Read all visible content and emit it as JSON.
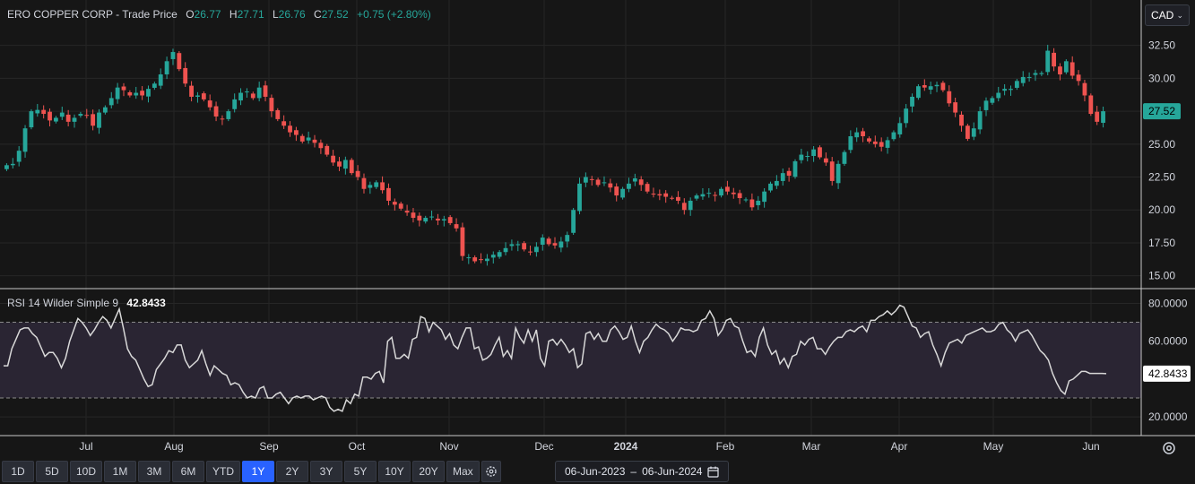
{
  "legend": {
    "symbol": "ERO COPPER CORP",
    "price_type": "- Trade Price",
    "open_label": "O",
    "open": "26.77",
    "high_label": "H",
    "high": "27.71",
    "low_label": "L",
    "low": "26.76",
    "close_label": "C",
    "close": "27.52",
    "change": "+0.75 (+2.80%)"
  },
  "currency": {
    "label": "CAD"
  },
  "price_axis": {
    "ticks": [
      "32.50",
      "30.00",
      "27.50",
      "25.00",
      "22.50",
      "20.00",
      "17.50",
      "15.00"
    ],
    "last_price_tag": "27.52"
  },
  "rsi": {
    "label": "RSI 14 Wilder Simple 9",
    "value": "42.8433",
    "ticks": [
      "80.0000",
      "60.0000",
      "20.0000"
    ],
    "value_tag": "42.8433"
  },
  "time_axis": {
    "labels": [
      "Jul",
      "Aug",
      "Sep",
      "Oct",
      "Nov",
      "Dec",
      "2024",
      "Feb",
      "Mar",
      "Apr",
      "May",
      "Jun"
    ]
  },
  "range_buttons": [
    {
      "label": "1D"
    },
    {
      "label": "5D"
    },
    {
      "label": "10D"
    },
    {
      "label": "1M"
    },
    {
      "label": "3M"
    },
    {
      "label": "6M"
    },
    {
      "label": "YTD"
    },
    {
      "label": "1Y",
      "active": true
    },
    {
      "label": "2Y"
    },
    {
      "label": "3Y"
    },
    {
      "label": "5Y"
    },
    {
      "label": "10Y"
    },
    {
      "label": "20Y"
    },
    {
      "label": "Max"
    }
  ],
  "date_range": {
    "from": "06-Jun-2023",
    "separator": "–",
    "to": "06-Jun-2024"
  },
  "colors": {
    "up": "#26a69a",
    "down": "#ef5350",
    "rsi_line": "#d8d8d8",
    "rsi_band": "#2a2533",
    "accent": "#2962ff"
  },
  "chart_data": [
    {
      "type": "candlestick",
      "title": "ERO COPPER CORP - Trade Price",
      "ylim": [
        14.5,
        33.5
      ],
      "y_ticks": [
        15,
        17.5,
        20,
        22.5,
        25,
        27.5,
        30,
        32.5
      ],
      "x_labels": [
        "Jul",
        "Aug",
        "Sep",
        "Oct",
        "Nov",
        "Dec",
        "2024",
        "Feb",
        "Mar",
        "Apr",
        "May",
        "Jun"
      ],
      "closes": [
        23.4,
        23.5,
        24.5,
        26.2,
        27.5,
        27.6,
        27.3,
        26.8,
        27.0,
        27.4,
        26.7,
        27.0,
        27.3,
        27.2,
        26.4,
        27.4,
        27.8,
        28.5,
        29.3,
        29.1,
        28.7,
        28.9,
        28.7,
        29.2,
        29.6,
        30.3,
        31.3,
        32.0,
        30.7,
        29.6,
        28.6,
        28.7,
        28.4,
        27.8,
        27.1,
        26.9,
        27.5,
        28.4,
        28.9,
        29.0,
        28.5,
        29.3,
        28.6,
        27.5,
        26.9,
        26.4,
        25.9,
        25.7,
        25.2,
        25.5,
        25.1,
        24.7,
        24.2,
        23.6,
        23.3,
        23.8,
        22.8,
        22.5,
        21.6,
        21.9,
        22.1,
        21.5,
        20.7,
        20.4,
        20.1,
        19.8,
        19.4,
        19.2,
        19.4,
        19.5,
        19.2,
        19.3,
        19.0,
        18.6,
        16.5,
        16.4,
        16.1,
        16.2,
        16.3,
        16.6,
        16.8,
        17.1,
        17.4,
        17.4,
        17.0,
        16.8,
        17.2,
        17.9,
        17.4,
        17.3,
        17.6,
        18.1,
        20.0,
        22.0,
        22.5,
        22.3,
        21.9,
        22.1,
        21.7,
        21.1,
        21.6,
        22.0,
        22.4,
        21.9,
        21.4,
        21.2,
        21.1,
        21.0,
        20.9,
        20.7,
        20.0,
        20.7,
        21.1,
        21.2,
        21.3,
        21.1,
        21.6,
        21.4,
        21.2,
        20.9,
        20.8,
        20.2,
        20.7,
        21.4,
        22.0,
        22.2,
        22.8,
        22.6,
        23.7,
        24.2,
        24.1,
        24.6,
        24.0,
        23.6,
        22.2,
        23.5,
        24.4,
        25.6,
        25.9,
        25.6,
        25.2,
        25.0,
        24.8,
        25.3,
        25.9,
        26.6,
        27.7,
        28.6,
        29.4,
        29.3,
        29.4,
        29.5,
        29.1,
        28.1,
        27.4,
        26.4,
        25.4,
        26.2,
        27.5,
        28.3,
        28.5,
        28.9,
        29.2,
        29.2,
        29.8,
        30.1,
        30.1,
        30.4,
        30.4,
        32.1,
        30.9,
        30.3,
        31.3,
        30.2,
        29.8,
        28.7,
        27.3,
        26.7,
        27.5
      ]
    },
    {
      "type": "line",
      "title": "RSI 14 Wilder Simple 9",
      "ylim": [
        12,
        84
      ],
      "y_ticks": [
        20,
        60,
        80
      ],
      "bands": [
        30,
        70
      ],
      "x_labels": [
        "Jul",
        "Aug",
        "Sep",
        "Oct",
        "Nov",
        "Dec",
        "2024",
        "Feb",
        "Mar",
        "Apr",
        "May",
        "Jun"
      ],
      "values": [
        47,
        47,
        56,
        61,
        66,
        67,
        67,
        64,
        62,
        57,
        52,
        54,
        54,
        51,
        46,
        51,
        60,
        66,
        72,
        70,
        67,
        63,
        66,
        70,
        73,
        71,
        67,
        72,
        77,
        67,
        56,
        52,
        50,
        45,
        40,
        36,
        37,
        45,
        48,
        51,
        55,
        54,
        58,
        58,
        50,
        46,
        48,
        50,
        55,
        48,
        42,
        47,
        45,
        43,
        42,
        37,
        38,
        37,
        33,
        30,
        31,
        30,
        35,
        36,
        30,
        30,
        32,
        33,
        30,
        27,
        30,
        31,
        30,
        31,
        31,
        29,
        30,
        31,
        30,
        25,
        23,
        24,
        23,
        29,
        27,
        32,
        31,
        41,
        41,
        40,
        43,
        44,
        38,
        60,
        62,
        51,
        51,
        53,
        51,
        61,
        62,
        73,
        72,
        65,
        70,
        68,
        66,
        61,
        64,
        58,
        56,
        62,
        67,
        67,
        56,
        57,
        50,
        51,
        53,
        58,
        62,
        52,
        55,
        51,
        67,
        62,
        59,
        66,
        60,
        66,
        51,
        47,
        60,
        61,
        58,
        61,
        58,
        54,
        56,
        46,
        48,
        64,
        65,
        61,
        64,
        60,
        60,
        66,
        68,
        65,
        61,
        62,
        68,
        60,
        54,
        60,
        62,
        66,
        69,
        67,
        66,
        64,
        60,
        63,
        67,
        66,
        66,
        65,
        66,
        71,
        72,
        76,
        72,
        63,
        66,
        71,
        72,
        68,
        67,
        60,
        54,
        55,
        52,
        62,
        67,
        58,
        53,
        55,
        48,
        51,
        46,
        52,
        53,
        60,
        58,
        61,
        62,
        56,
        56,
        53,
        57,
        60,
        62,
        62,
        65,
        66,
        65,
        67,
        68,
        65,
        71,
        71,
        73,
        74,
        76,
        74,
        76,
        79,
        78,
        73,
        68,
        67,
        62,
        64,
        65,
        58,
        53,
        47,
        54,
        59,
        60,
        61,
        59,
        63,
        64,
        65,
        66,
        67,
        65,
        65,
        66,
        69,
        70,
        66,
        64,
        60,
        64,
        65,
        66,
        63,
        59,
        55,
        53,
        50,
        43,
        38,
        34,
        32,
        39,
        40,
        42,
        44,
        44,
        43,
        43,
        43,
        43,
        42.8433
      ]
    }
  ]
}
